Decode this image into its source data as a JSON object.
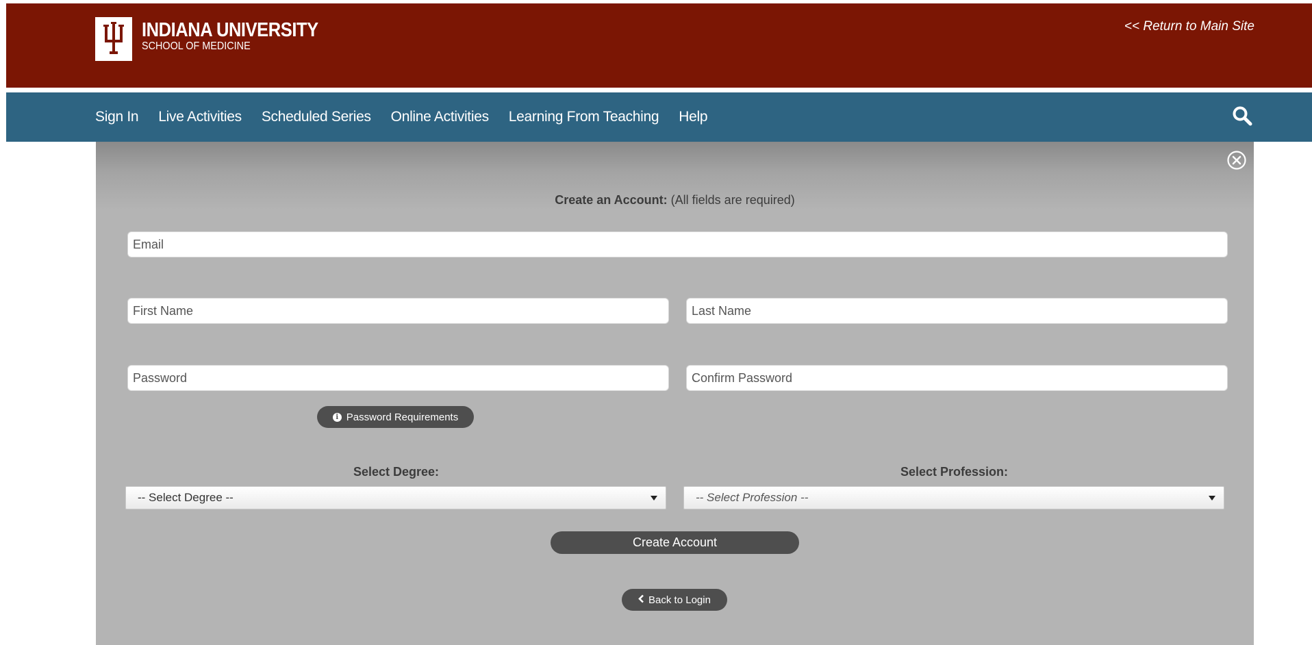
{
  "header": {
    "brand_title": "INDIANA UNIVERSITY",
    "brand_subtitle": "SCHOOL OF MEDICINE",
    "logo_icon": "iu-trident-icon",
    "return_link": "<< Return to Main Site",
    "background_color": "#7b1604"
  },
  "nav": {
    "background_color": "#2e6482",
    "items": [
      {
        "label": "Sign In"
      },
      {
        "label": "Live Activities"
      },
      {
        "label": "Scheduled Series"
      },
      {
        "label": "Online Activities"
      },
      {
        "label": "Learning From Teaching"
      },
      {
        "label": "Help"
      }
    ],
    "search_icon": "search-icon"
  },
  "form": {
    "title_bold": "Create an Account:",
    "title_note": "(All fields are required)",
    "close_icon": "close-circle-icon",
    "fields": {
      "email": {
        "placeholder": "Email",
        "value": ""
      },
      "first_name": {
        "placeholder": "First Name",
        "value": ""
      },
      "last_name": {
        "placeholder": "Last Name",
        "value": ""
      },
      "password": {
        "placeholder": "Password",
        "value": ""
      },
      "confirm_password": {
        "placeholder": "Confirm Password",
        "value": ""
      }
    },
    "password_requirements_label": "Password Requirements",
    "degree": {
      "label": "Select Degree:",
      "selected": "-- Select Degree --"
    },
    "profession": {
      "label": "Select Profession:",
      "selected": "-- Select Profession --"
    },
    "create_button": "Create Account",
    "back_button": "Back to Login"
  }
}
